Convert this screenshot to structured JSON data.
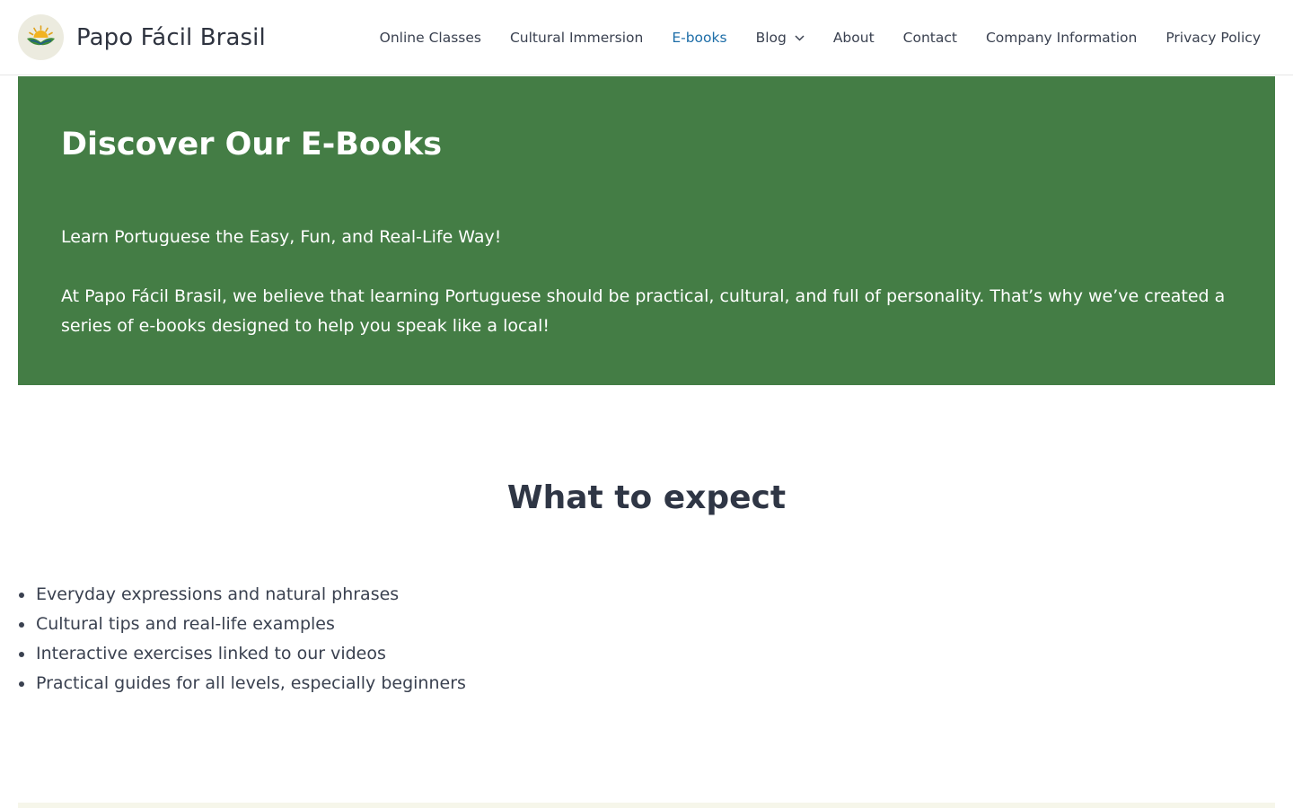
{
  "header": {
    "site_title": "Papo Fácil Brasil",
    "logo_icon": "sunrise-hands-logo-icon",
    "nav": [
      {
        "label": "Online Classes",
        "active": false
      },
      {
        "label": "Cultural Immersion",
        "active": false
      },
      {
        "label": "E-books",
        "active": true
      },
      {
        "label": "Blog",
        "active": false,
        "has_dropdown": true
      },
      {
        "label": "About",
        "active": false
      },
      {
        "label": "Contact",
        "active": false
      },
      {
        "label": "Company Information",
        "active": false
      },
      {
        "label": "Privacy Policy",
        "active": false
      }
    ]
  },
  "hero": {
    "title": "Discover Our E-Books",
    "tagline": "Learn Portuguese the Easy, Fun, and Real-Life Way!",
    "description": "At Papo Fácil Brasil, we believe that learning Portuguese should be practical, cultural, and full of personality. That’s why we’ve created a series of e-books designed to help you speak like a local!",
    "background_color": "#447d45"
  },
  "expect": {
    "title": "What to expect",
    "items": [
      "Everyday expressions and natural phrases",
      "Cultural tips and real-life examples",
      "Interactive exercises linked to our videos",
      "Practical guides for all levels, especially beginners"
    ]
  },
  "colors": {
    "accent": "#1e6ea8",
    "text": "#3a4150",
    "hero_green": "#447d45"
  }
}
